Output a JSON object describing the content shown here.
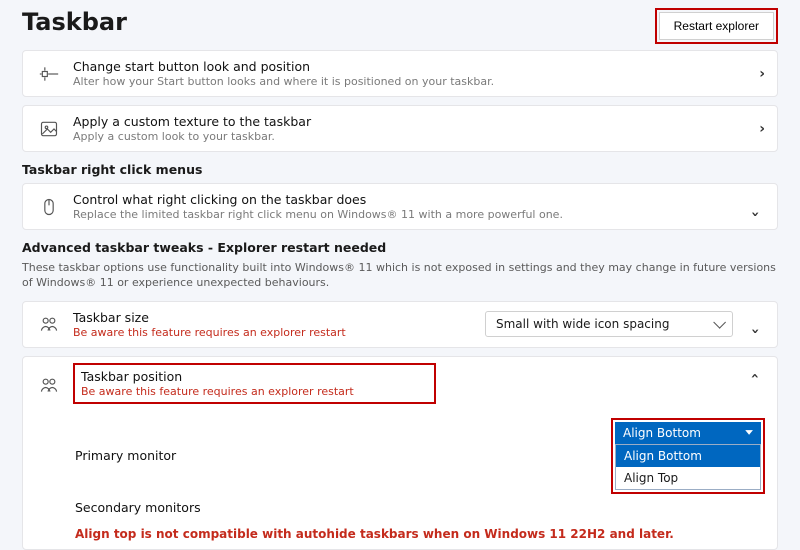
{
  "header": {
    "title": "Taskbar",
    "restart_label": "Restart explorer"
  },
  "card_start": {
    "title": "Change start button look and position",
    "sub": "Alter how your Start button looks and where it is positioned on your taskbar."
  },
  "card_texture": {
    "title": "Apply a custom texture to the taskbar",
    "sub": "Apply a custom look to your taskbar."
  },
  "section_rightclick": {
    "heading": "Taskbar right click menus"
  },
  "card_rightclick": {
    "title": "Control what right clicking on the taskbar does",
    "sub": "Replace the limited taskbar right click menu on Windows® 11 with a more powerful one."
  },
  "section_advanced": {
    "heading": "Advanced taskbar tweaks - Explorer restart needed",
    "desc": "These taskbar options use functionality built into Windows® 11 which is not exposed in settings and they may change in future versions of Windows® 11 or experience unexpected behaviours."
  },
  "card_size": {
    "title": "Taskbar size",
    "warn": "Be aware this feature requires an explorer restart",
    "select_value": "Small with wide icon spacing"
  },
  "card_position": {
    "title": "Taskbar position",
    "warn": "Be aware this feature requires an explorer restart",
    "primary_label": "Primary monitor",
    "secondary_label": "Secondary monitors",
    "dropdown": {
      "selected": "Align Bottom",
      "options": [
        "Align Bottom",
        "Align Top"
      ]
    },
    "compat_warning": "Align top is not compatible with autohide taskbars when on Windows 11 22H2 and later."
  }
}
